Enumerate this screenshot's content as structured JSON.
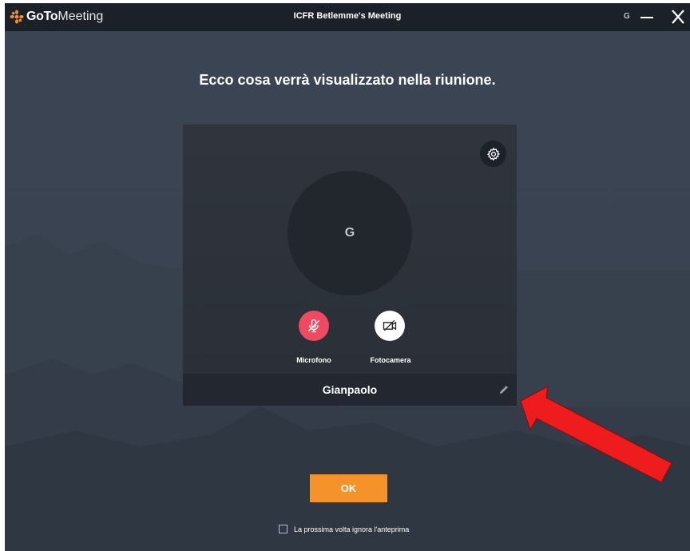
{
  "app": {
    "logo_goto": "GoTo",
    "logo_meeting": "Meeting",
    "window_title": "ICFR Betlemme's Meeting",
    "user_initial": "G"
  },
  "main": {
    "headline": "Ecco cosa verrà visualizzato nella riunione.",
    "avatar_initial": "G",
    "mic_label": "Microfono",
    "mic_muted": true,
    "camera_label": "Fotocamera",
    "camera_off": true,
    "display_name": "Gianpaolo",
    "ok_label": "OK",
    "skip_preview_label": "La prossima volta ignora l'anteprima",
    "skip_preview_checked": false
  },
  "colors": {
    "accent_orange": "#f5922a",
    "mic_red": "#ef4a62",
    "titlebar": "#1c2028",
    "background": "#3a4351",
    "annotation_arrow": "#ee1c1c"
  },
  "icons": {
    "logo": "gotomeeting-logo-icon",
    "settings": "gear-icon",
    "microphone": "microphone-off-icon",
    "camera": "camera-off-icon",
    "edit": "pencil-icon",
    "minimize": "minimize-icon",
    "close": "close-icon",
    "annotation": "red-arrow-icon"
  }
}
